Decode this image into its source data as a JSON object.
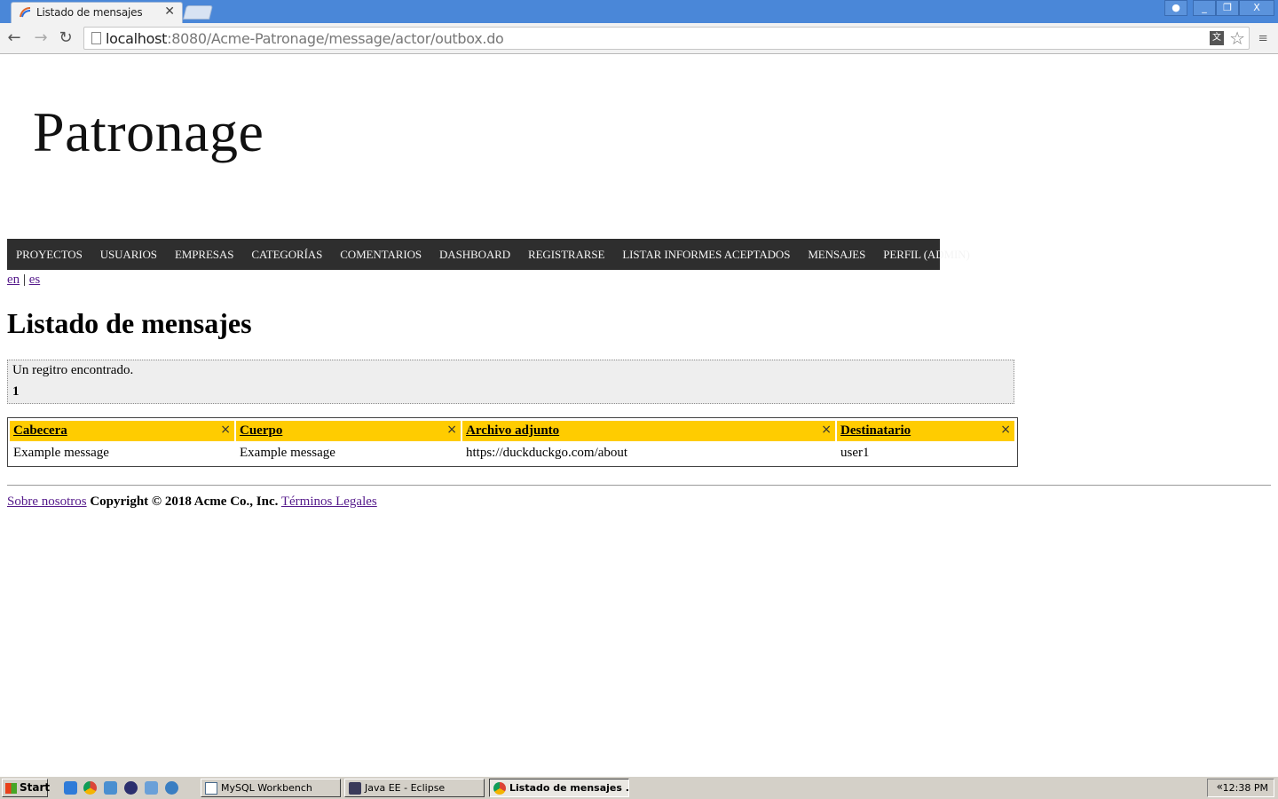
{
  "browser": {
    "tab_title": "Listado de mensajes",
    "url_host": "localhost",
    "url_rest": ":8080/Acme-Patronage/message/actor/outbox.do",
    "icons": [
      "back-icon",
      "forward-icon",
      "reload-icon",
      "page-icon",
      "translate-icon",
      "star-icon",
      "menu-icon"
    ]
  },
  "site": {
    "logo": "Patronage"
  },
  "menu": {
    "items": [
      {
        "label": "PROYECTOS"
      },
      {
        "label": "USUARIOS"
      },
      {
        "label": "EMPRESAS"
      },
      {
        "label": "CATEGORÍAS"
      },
      {
        "label": "COMENTARIOS"
      },
      {
        "label": "DASHBOARD"
      },
      {
        "label": "REGISTRARSE"
      },
      {
        "label": "LISTAR INFORMES ACEPTADOS"
      },
      {
        "label": "MENSAJES"
      },
      {
        "label": "PERFIL (ADMIN)"
      }
    ]
  },
  "lang": {
    "en": "en",
    "sep": "|",
    "es": "es"
  },
  "page": {
    "title": "Listado de mensajes",
    "count_text": "Un regitro encontrado.",
    "page_number": "1"
  },
  "table": {
    "headers": [
      "Cabecera",
      "Cuerpo",
      "Archivo adjunto",
      "Destinatario"
    ],
    "close_glyph": "×",
    "rows": [
      [
        "Example message",
        "Example message",
        "https://duckduckgo.com/about",
        "user1"
      ]
    ]
  },
  "footer": {
    "about": "Sobre nosotros",
    "copyright": "Copyright © 2018 Acme Co., Inc.",
    "legal": "Términos Legales"
  },
  "taskbar": {
    "start": "Start",
    "tasks": [
      "MySQL Workbench",
      "Java EE - Eclipse",
      "Listado de mensajes ..."
    ],
    "clock": "12:38 PM"
  },
  "colors": {
    "menubar": "#2e2e2e",
    "table_header": "#ffcc00",
    "link": "#551a8b",
    "chrome": "#4a87d8"
  }
}
